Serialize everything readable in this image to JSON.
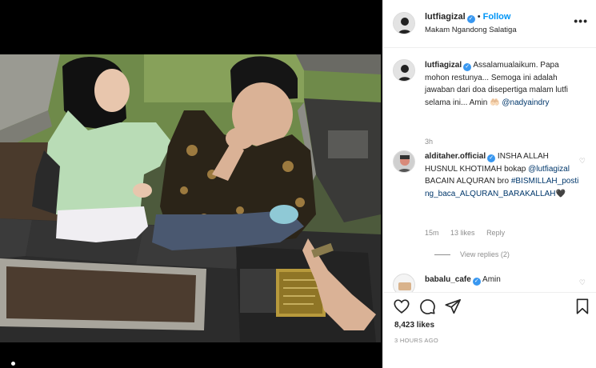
{
  "post": {
    "username": "lutfiagizal",
    "follow_label": "Follow",
    "location": "Makam Ngandong Salatiga",
    "more_label": "•••",
    "verified_mark": "✓",
    "separator": "•"
  },
  "comments": [
    {
      "username": "lutfiagizal",
      "text": "Assalamualaikum. Papa mohon restunya... Semoga ini adalah jawaban dari doa disepertiga malam lutfi selama ini... Amin 🤲🏻",
      "mention": "@nadyaindry",
      "time": "3h"
    },
    {
      "username": "alditaher.official",
      "text": "INSHA ALLAH HUSNUL KHOTIMAH bokap",
      "mention": "@lutfiagizal",
      "text2": "BACAIN ALQURAN bro",
      "hashtags": "#BISMILLAH_posting_baca_ALQURAN_BARAKALLAH",
      "heart_emoji": "🖤",
      "time": "15m",
      "likes": "13 likes",
      "reply_label": "Reply",
      "view_replies": "View replies (2)"
    },
    {
      "username": "babalu_cafe",
      "text": "Amin"
    }
  ],
  "footer": {
    "likes": "8,423 likes",
    "timestamp": "3 HOURS AGO"
  },
  "icons": {
    "heart": "heart-icon",
    "comment": "comment-icon",
    "share": "paper-plane-icon",
    "save": "bookmark-icon"
  },
  "colors": {
    "link_blue": "#0095f6",
    "mention": "#00376b",
    "verified": "#3897f0",
    "muted": "#8e8e8e"
  }
}
